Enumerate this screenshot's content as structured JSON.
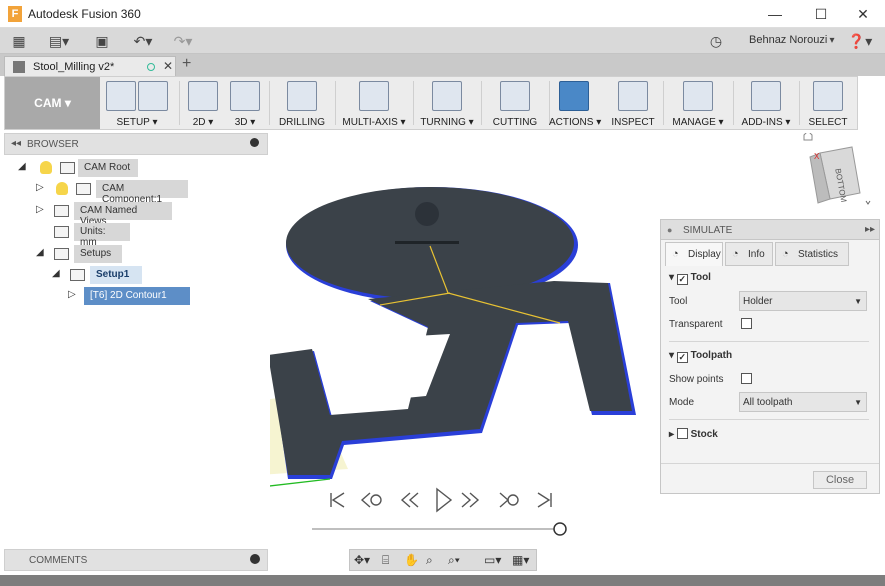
{
  "window": {
    "title": "Autodesk Fusion 360",
    "app_icon": "F"
  },
  "qat": {
    "user": "Behnaz Norouzi"
  },
  "document_tab": {
    "name": "Stool_Milling v2*"
  },
  "ribbon": {
    "workspace": "CAM",
    "groups": [
      {
        "label": "SETUP ▾"
      },
      {
        "label": "2D ▾"
      },
      {
        "label": "3D ▾"
      },
      {
        "label": "DRILLING"
      },
      {
        "label": "MULTI-AXIS ▾"
      },
      {
        "label": "TURNING ▾"
      },
      {
        "label": "CUTTING"
      },
      {
        "label": "ACTIONS ▾"
      },
      {
        "label": "INSPECT"
      },
      {
        "label": "MANAGE ▾"
      },
      {
        "label": "ADD-INS ▾"
      },
      {
        "label": "SELECT"
      }
    ]
  },
  "browser": {
    "title": "BROWSER",
    "items": [
      {
        "label": "CAM Root"
      },
      {
        "label": "CAM Component:1"
      },
      {
        "label": "CAM Named Views"
      },
      {
        "label": "Units: mm"
      },
      {
        "label": "Setups"
      },
      {
        "label": "Setup1"
      },
      {
        "label": "[T6] 2D Contour1"
      }
    ]
  },
  "viewcube": {
    "face": "BOTTOM",
    "axis_x": "X"
  },
  "simulate": {
    "title": "SIMULATE",
    "tabs": [
      {
        "label": "Display"
      },
      {
        "label": "Info"
      },
      {
        "label": "Statistics"
      }
    ],
    "tool_section": "Tool",
    "tool_label": "Tool",
    "tool_value": "Holder",
    "transparent_label": "Transparent",
    "toolpath_section": "Toolpath",
    "show_points_label": "Show points",
    "mode_label": "Mode",
    "mode_value": "All toolpath",
    "stock_section": "Stock",
    "close_label": "Close"
  },
  "comments": {
    "title": "COMMENTS"
  },
  "playback": {
    "progress": 1.0
  }
}
